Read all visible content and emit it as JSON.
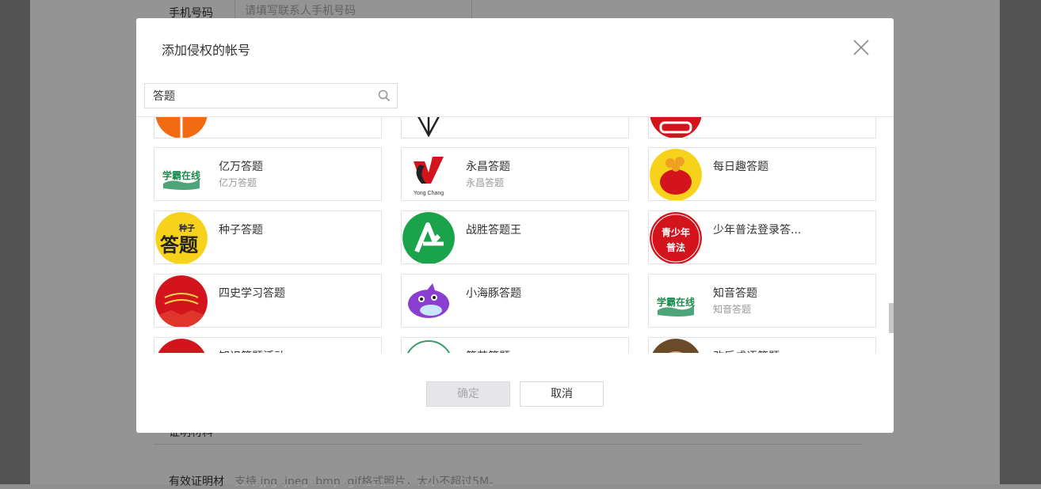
{
  "background": {
    "phone_label": "手机号码",
    "phone_placeholder": "请填写联系人手机号码",
    "proof_label": "证明材料",
    "valid_label": "有效证明材",
    "valid_hint": "支持.jpg .jpeg .bmp .gif格式照片，大小不超过5M。"
  },
  "modal": {
    "title": "添加侵权的帐号",
    "search": {
      "value": "答题"
    },
    "buttons": {
      "ok": "确定",
      "cancel": "取消"
    }
  },
  "accounts": [
    {
      "name": "",
      "sub": "",
      "avatar": "orange-ball"
    },
    {
      "name": "",
      "sub": "",
      "avatar": "arrow-down"
    },
    {
      "name": "",
      "sub": "",
      "avatar": "red-car"
    },
    {
      "name": "亿万答题",
      "sub": "亿万答题",
      "avatar": "xueba-logo"
    },
    {
      "name": "永昌答题",
      "sub": "永昌答题",
      "avatar": "yongchang-logo"
    },
    {
      "name": "每日趣答题",
      "sub": "",
      "avatar": "red-bag"
    },
    {
      "name": "种子答题",
      "sub": "",
      "avatar": "seed-logo"
    },
    {
      "name": "战胜答题王",
      "sub": "",
      "avatar": "green-a-logo"
    },
    {
      "name": "少年普法登录答...",
      "sub": "",
      "avatar": "pufa-logo"
    },
    {
      "name": "四史学习答题",
      "sub": "",
      "avatar": "red-banner"
    },
    {
      "name": "小海豚答题",
      "sub": "",
      "avatar": "dolphin"
    },
    {
      "name": "知音答题",
      "sub": "知音答题",
      "avatar": "xueba-logo"
    },
    {
      "name": "知识答题活动",
      "sub": "",
      "avatar": "red-plain"
    },
    {
      "name": "答苗答题",
      "sub": "",
      "avatar": "green-ring"
    },
    {
      "name": "改后成语答题",
      "sub": "",
      "avatar": "dog-photo"
    }
  ],
  "avatar_text": {
    "xueba": "学霸在线",
    "seed_top": "种子",
    "seed_main": "答题",
    "pufa_1": "青少年",
    "pufa_2": "普法",
    "yongchang": "Yong   Chang"
  },
  "colors": {
    "orange": "#f26a12",
    "red": "#d3141c",
    "green": "#1aa34a",
    "yellow": "#f7d21a",
    "purple": "#8a3fd1"
  }
}
